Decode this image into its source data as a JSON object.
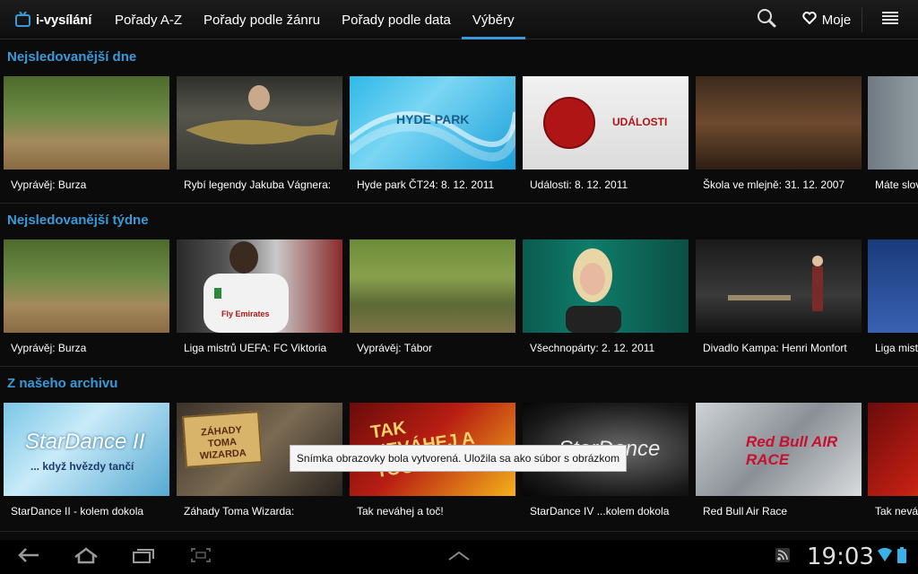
{
  "app": {
    "logo_text": "i-vysílání"
  },
  "tabs": [
    {
      "label": "Pořady A-Z"
    },
    {
      "label": "Pořady podle žánru"
    },
    {
      "label": "Pořady podle data"
    },
    {
      "label": "Výběry",
      "active": true
    }
  ],
  "actions": {
    "search_icon": "search-icon",
    "moje_label": "Moje",
    "menu_icon": "menu-icon"
  },
  "sections": [
    {
      "title": "Nejsledovanější dne",
      "items": [
        {
          "caption": "Vyprávěj: Burza"
        },
        {
          "caption": "Rybí legendy Jakuba Vágnera:"
        },
        {
          "caption": "Hyde park ČT24: 8. 12. 2011",
          "thumb_text": "HYDE PARK"
        },
        {
          "caption": "Události: 8. 12. 2011",
          "thumb_text": "UDÁLOSTI"
        },
        {
          "caption": "Škola ve mlejně: 31. 12. 2007"
        },
        {
          "caption": "Máte slov"
        }
      ]
    },
    {
      "title": "Nejsledovanější týdne",
      "items": [
        {
          "caption": "Vyprávěj: Burza"
        },
        {
          "caption": "Liga mistrů UEFA: FC Viktoria",
          "thumb_text": "Fly Emirates"
        },
        {
          "caption": "Vyprávěj: Tábor"
        },
        {
          "caption": "Všechnopárty: 2. 12. 2011"
        },
        {
          "caption": "Divadlo Kampa: Henri Monfort"
        },
        {
          "caption": "Liga mistr"
        }
      ]
    },
    {
      "title": "Z našeho archivu",
      "items": [
        {
          "caption": "StarDance II - kolem dokola",
          "thumb_text": "StarDance II",
          "thumb_sub": "... když hvězdy tančí"
        },
        {
          "caption": "Záhady Toma Wizarda:",
          "thumb_text": "ZÁHADY TOMA WIZARDA"
        },
        {
          "caption": "Tak neváhej a toč!",
          "thumb_text": "TAK NEVÁHEJ A TOČ!"
        },
        {
          "caption": "StarDance IV ...kolem dokola",
          "thumb_text": "StarDance"
        },
        {
          "caption": "Red Bull Air Race",
          "thumb_text": "Red Bull AIR RACE"
        },
        {
          "caption": "Tak nevá"
        }
      ]
    }
  ],
  "toast": {
    "text": "Snímka obrazovky bola vytvorená. Uložila sa ako súbor s obrázkom"
  },
  "status": {
    "time": "19:03"
  },
  "colors": {
    "accent": "#3a9ad9",
    "background": "#0b0b0b",
    "toast_bg": "#f5f5f5"
  }
}
